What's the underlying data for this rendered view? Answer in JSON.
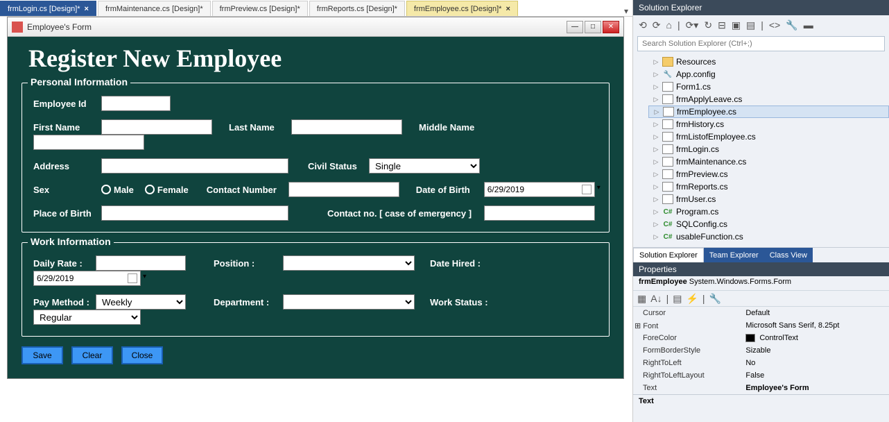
{
  "tabs": [
    {
      "label": "frmLogin.cs [Design]*",
      "closable": true,
      "kind": "login"
    },
    {
      "label": "frmMaintenance.cs [Design]*",
      "closable": false,
      "kind": "normal"
    },
    {
      "label": "frmPreview.cs [Design]*",
      "closable": false,
      "kind": "normal"
    },
    {
      "label": "frmReports.cs [Design]*",
      "closable": false,
      "kind": "normal"
    },
    {
      "label": "frmEmployee.cs [Design]*",
      "closable": true,
      "kind": "active"
    }
  ],
  "form": {
    "windowTitle": "Employee's Form",
    "heading": "Register New Employee",
    "group1": "Personal Information",
    "group2": "Work Information",
    "labels": {
      "empid": "Employee Id",
      "fname": "First Name",
      "lname": "Last Name",
      "mname": "Middle Name",
      "address": "Address",
      "civil": "Civil Status",
      "sex": "Sex",
      "male": "Male",
      "female": "Female",
      "contact": "Contact Number",
      "dob": "Date of Birth",
      "pob": "Place of Birth",
      "emergency": "Contact no. [ case of emergency ]",
      "drate": "Daily Rate :",
      "position": "Position :",
      "dhired": "Date Hired :",
      "paymethod": "Pay Method :",
      "dept": "Department :",
      "wstatus": "Work Status :"
    },
    "values": {
      "civil": "Single",
      "dob": "6/29/2019",
      "dhired": "6/29/2019",
      "paymethod": "Weekly",
      "wstatus": "Regular"
    },
    "buttons": {
      "save": "Save",
      "clear": "Clear",
      "close": "Close"
    }
  },
  "solutionExplorer": {
    "title": "Solution Explorer",
    "searchPlaceholder": "Search Solution Explorer (Ctrl+;)",
    "items": [
      {
        "kind": "folder",
        "label": "Resources"
      },
      {
        "kind": "wrench",
        "label": "App.config"
      },
      {
        "kind": "form",
        "label": "Form1.cs"
      },
      {
        "kind": "form",
        "label": "frmApplyLeave.cs"
      },
      {
        "kind": "form",
        "label": "frmEmployee.cs",
        "selected": true
      },
      {
        "kind": "form",
        "label": "frmHistory.cs"
      },
      {
        "kind": "form",
        "label": "frmListofEmployee.cs"
      },
      {
        "kind": "form",
        "label": "frmLogin.cs"
      },
      {
        "kind": "form",
        "label": "frmMaintenance.cs"
      },
      {
        "kind": "form",
        "label": "frmPreview.cs"
      },
      {
        "kind": "form",
        "label": "frmReports.cs"
      },
      {
        "kind": "form",
        "label": "frmUser.cs"
      },
      {
        "kind": "cs",
        "label": "Program.cs"
      },
      {
        "kind": "cs",
        "label": "SQLConfig.cs"
      },
      {
        "kind": "cs",
        "label": "usableFunction.cs"
      }
    ],
    "tabs": {
      "se": "Solution Explorer",
      "te": "Team Explorer",
      "cv": "Class View"
    }
  },
  "properties": {
    "title": "Properties",
    "objectName": "frmEmployee",
    "objectType": "System.Windows.Forms.Form",
    "rows": [
      {
        "name": "Cursor",
        "value": "Default"
      },
      {
        "name": "Font",
        "value": "Microsoft Sans Serif, 8.25pt",
        "expandable": true
      },
      {
        "name": "ForeColor",
        "value": "ControlText",
        "color": "#000"
      },
      {
        "name": "FormBorderStyle",
        "value": "Sizable"
      },
      {
        "name": "RightToLeft",
        "value": "No"
      },
      {
        "name": "RightToLeftLayout",
        "value": "False"
      },
      {
        "name": "Text",
        "value": "Employee's Form",
        "bold": true
      }
    ],
    "summaryLabel": "Text"
  }
}
